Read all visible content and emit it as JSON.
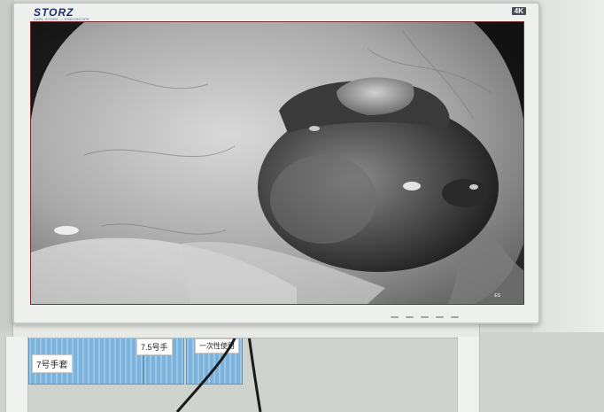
{
  "monitor": {
    "brand": "STORZ",
    "brand_subtitle": "KARL STORZ — ENDOSKOPE",
    "resolution_badge": "4K",
    "corner_mark": "ES",
    "control_count": 5
  },
  "shelf": {
    "label_left": "7号手套",
    "label_middle": "7.5号手",
    "label_right": "一次性使用"
  },
  "colors": {
    "brand": "#1e2d6b",
    "bin": "#7bb3dd",
    "screen_border": "#7a2c2c"
  }
}
